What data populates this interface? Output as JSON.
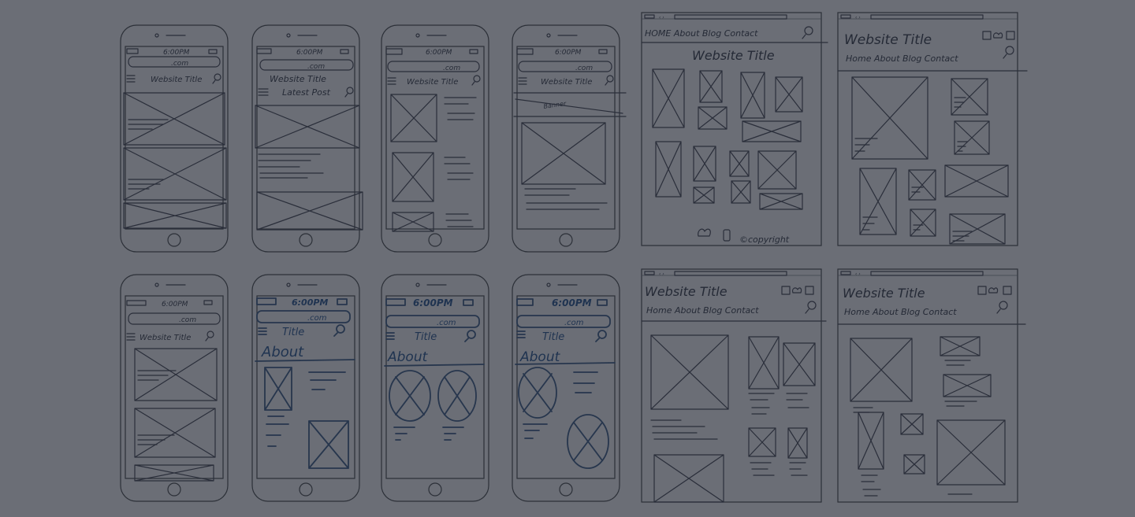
{
  "phones_top": [
    {
      "time": "6:00PM",
      "url": ".com",
      "title": "Website Title",
      "subtitle": ""
    },
    {
      "time": "6:00PM",
      "url": ".com",
      "title": "Website Title",
      "subtitle": "Latest Post"
    },
    {
      "time": "6:00PM",
      "url": ".com",
      "title": "Website Title",
      "subtitle": ""
    },
    {
      "time": "6:00PM",
      "url": ".com",
      "title": "Website Title",
      "subtitle": "",
      "banner": "Banner"
    }
  ],
  "phones_bottom": [
    {
      "time": "6:00PM",
      "url": ".com",
      "title": "Website Title",
      "heading": ""
    },
    {
      "time": "6:00PM",
      "url": ".com",
      "title": "Title",
      "heading": "About"
    },
    {
      "time": "6:00PM",
      "url": ".com",
      "title": "Title",
      "heading": "About"
    },
    {
      "time": "6:00PM",
      "url": ".com",
      "title": "Title",
      "heading": "About"
    }
  ],
  "desktops": [
    {
      "nav": "HOME About Blog Contact",
      "title": "Website Title",
      "footer": "©copyright"
    },
    {
      "title": "Website Title",
      "nav": "Home About Blog Contact"
    },
    {
      "title": "Website Title",
      "nav": "Home About Blog Contact"
    },
    {
      "title": "Website Title",
      "nav": "Home About Blog Contact"
    }
  ],
  "colors": {
    "background": "#6b6e76",
    "ink": "#2a2e3a",
    "blue_ink": "#27364d"
  }
}
